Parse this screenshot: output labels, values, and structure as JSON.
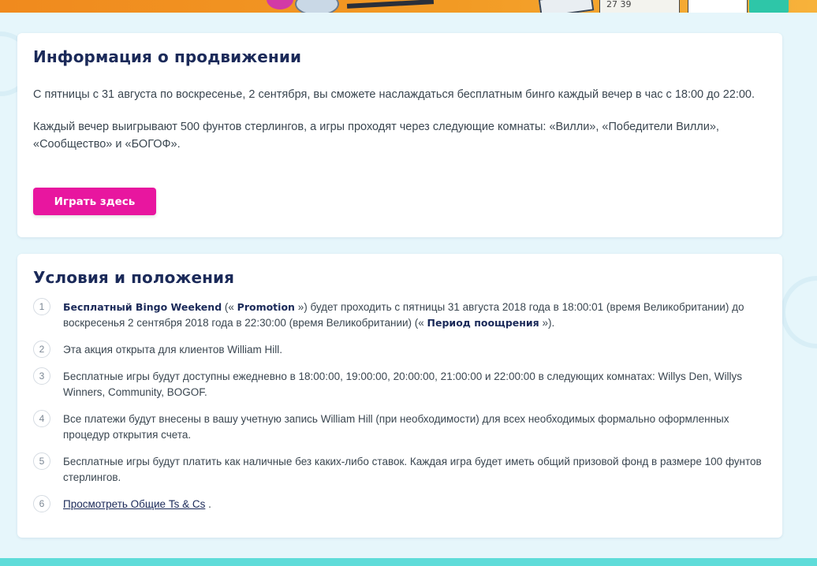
{
  "colors": {
    "accent": "#e8169f",
    "heading": "#1b2a59",
    "page_bg": "#e6f6fb",
    "bottom_bar": "#5fdcd9"
  },
  "banner": {
    "ticket_numbers": "27  39"
  },
  "promo": {
    "title": "Информация о продвижении",
    "para1": "С пятницы с 31 августа по воскресенье, 2 сентября, вы сможете наслаждаться бесплатным бинго каждый вечер в час с 18:00 до 22:00.",
    "para2": "Каждый вечер выигрывают 500 фунтов стерлингов, а игры проходят через следующие комнаты: «Вилли», «Победители Вилли», «Сообщество» и «БОГОФ».",
    "play_button": "Играть здесь"
  },
  "terms": {
    "title": "Условия и положения",
    "item1": {
      "num": "1",
      "bold1": "Бесплатный Bingo Weekend",
      "t1": " (« ",
      "bold2": "Promotion",
      "t2": " ») будет проходить с пятницы 31 августа 2018 года в 18:00:01 (время Великобритании) до воскресенья 2 сентября 2018 года в 22:30:00 (время Великобритании) (« ",
      "bold3": "Период поощрения",
      "t3": " »)."
    },
    "item2": {
      "num": "2",
      "text": "Эта акция открыта для клиентов William Hill."
    },
    "item3": {
      "num": "3",
      "text": "Бесплатные игры будут доступны ежедневно в 18:00:00, 19:00:00, 20:00:00, 21:00:00 и 22:00:00 в следующих комнатах: Willys Den, Willys Winners, Community, BOGOF."
    },
    "item4": {
      "num": "4",
      "text": "Все платежи будут внесены в вашу учетную запись William Hill (при необходимости) для всех необходимых формально оформленных процедур открытия счета."
    },
    "item5": {
      "num": "5",
      "text": "Бесплатные игры будут платить как наличные без каких-либо ставок. Каждая игра будет иметь общий призовой фонд в размере 100 фунтов стерлингов."
    },
    "item6": {
      "num": "6",
      "link": "Просмотреть Общие Ts & Cs",
      "tail": " ."
    }
  }
}
